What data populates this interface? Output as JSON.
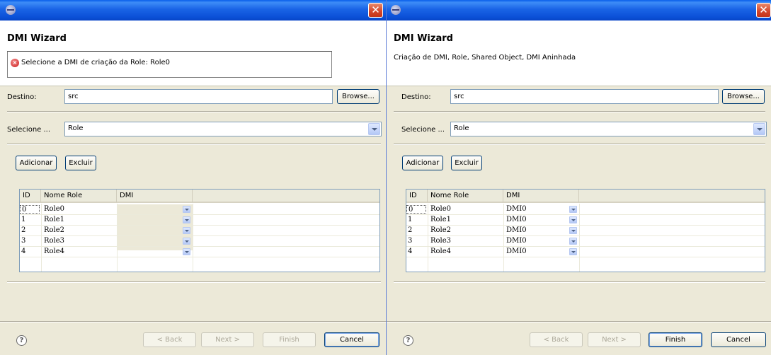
{
  "left": {
    "wizard_title": "DMI Wizard",
    "close_glyph": "✕",
    "error_message": "Selecione a DMI de criação da Role: Role0",
    "destino_label": "Destino:",
    "destino_value": "src",
    "browse_label": "Browse...",
    "selecione_label": "Selecione ...",
    "selecione_value": "Role",
    "adicionar_label": "Adicionar",
    "excluir_label": "Excluir",
    "table_headers": [
      "ID",
      "Nome Role",
      "DMI"
    ],
    "rows": [
      {
        "id": "0",
        "name": "Role0",
        "dmi": ""
      },
      {
        "id": "1",
        "name": "Role1",
        "dmi": ""
      },
      {
        "id": "2",
        "name": "Role2",
        "dmi": ""
      },
      {
        "id": "3",
        "name": "Role3",
        "dmi": ""
      },
      {
        "id": "4",
        "name": "Role4",
        "dmi": ""
      }
    ],
    "help_glyph": "?",
    "back_label": "< Back",
    "next_label": "Next >",
    "finish_label": "Finish",
    "cancel_label": "Cancel"
  },
  "right": {
    "wizard_title": "DMI Wizard",
    "close_glyph": "✕",
    "description": "Criação de DMI, Role, Shared Object, DMI Aninhada",
    "destino_label": "Destino:",
    "destino_value": "src",
    "browse_label": "Browse...",
    "selecione_label": "Selecione ...",
    "selecione_value": "Role",
    "adicionar_label": "Adicionar",
    "excluir_label": "Excluir",
    "table_headers": [
      "ID",
      "Nome Role",
      "DMI"
    ],
    "rows": [
      {
        "id": "0",
        "name": "Role0",
        "dmi": "DMI0"
      },
      {
        "id": "1",
        "name": "Role1",
        "dmi": "DMI0"
      },
      {
        "id": "2",
        "name": "Role2",
        "dmi": "DMI0"
      },
      {
        "id": "3",
        "name": "Role3",
        "dmi": "DMI0"
      },
      {
        "id": "4",
        "name": "Role4",
        "dmi": "DMI0"
      }
    ],
    "help_glyph": "?",
    "back_label": "< Back",
    "next_label": "Next >",
    "finish_label": "Finish",
    "cancel_label": "Cancel"
  },
  "colors": {
    "titlebar": "#0a4fd6",
    "dialog_bg": "#ece9d8",
    "close_button": "#d3442a",
    "error_icon": "#cc1e1e"
  }
}
